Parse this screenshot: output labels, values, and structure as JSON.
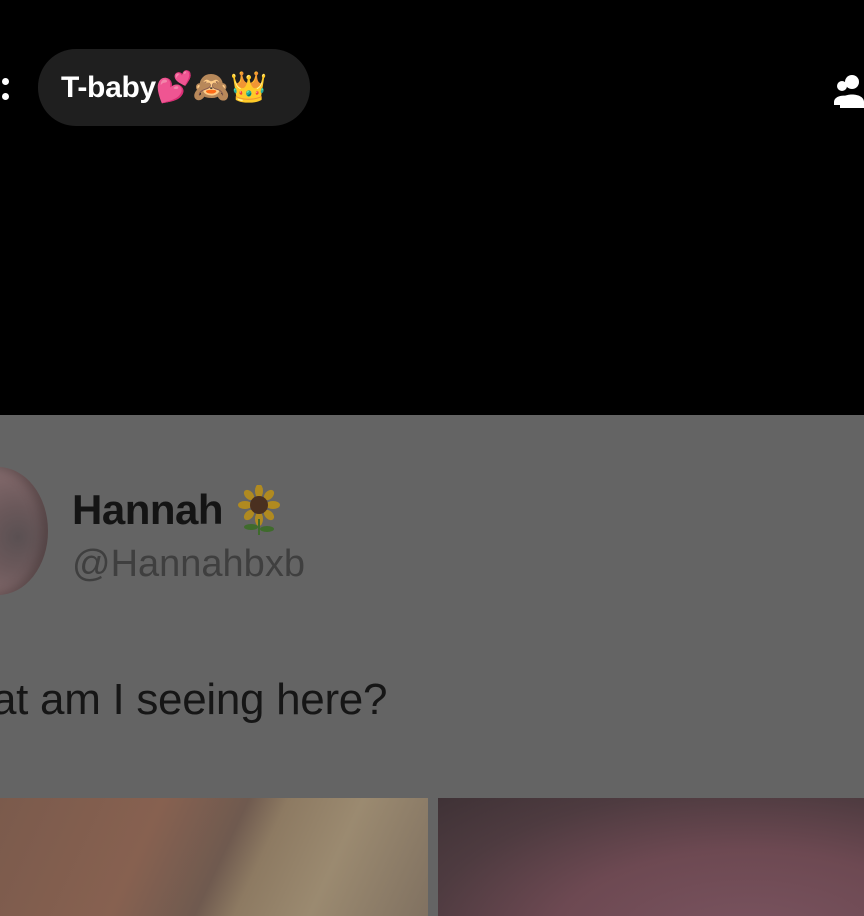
{
  "header": {
    "title": "T-baby💕🙈👑",
    "more_icon": "more-vertical-icon",
    "people_icon": "group-people-icon"
  },
  "post": {
    "author_name": "Hannah",
    "author_emoji": "🌻",
    "author_handle": "@Hannahbxb",
    "text": "at am I seeing here?"
  },
  "colors": {
    "background": "#000000",
    "pill": "#1f1f1f",
    "overlay_gray": "#646464"
  }
}
